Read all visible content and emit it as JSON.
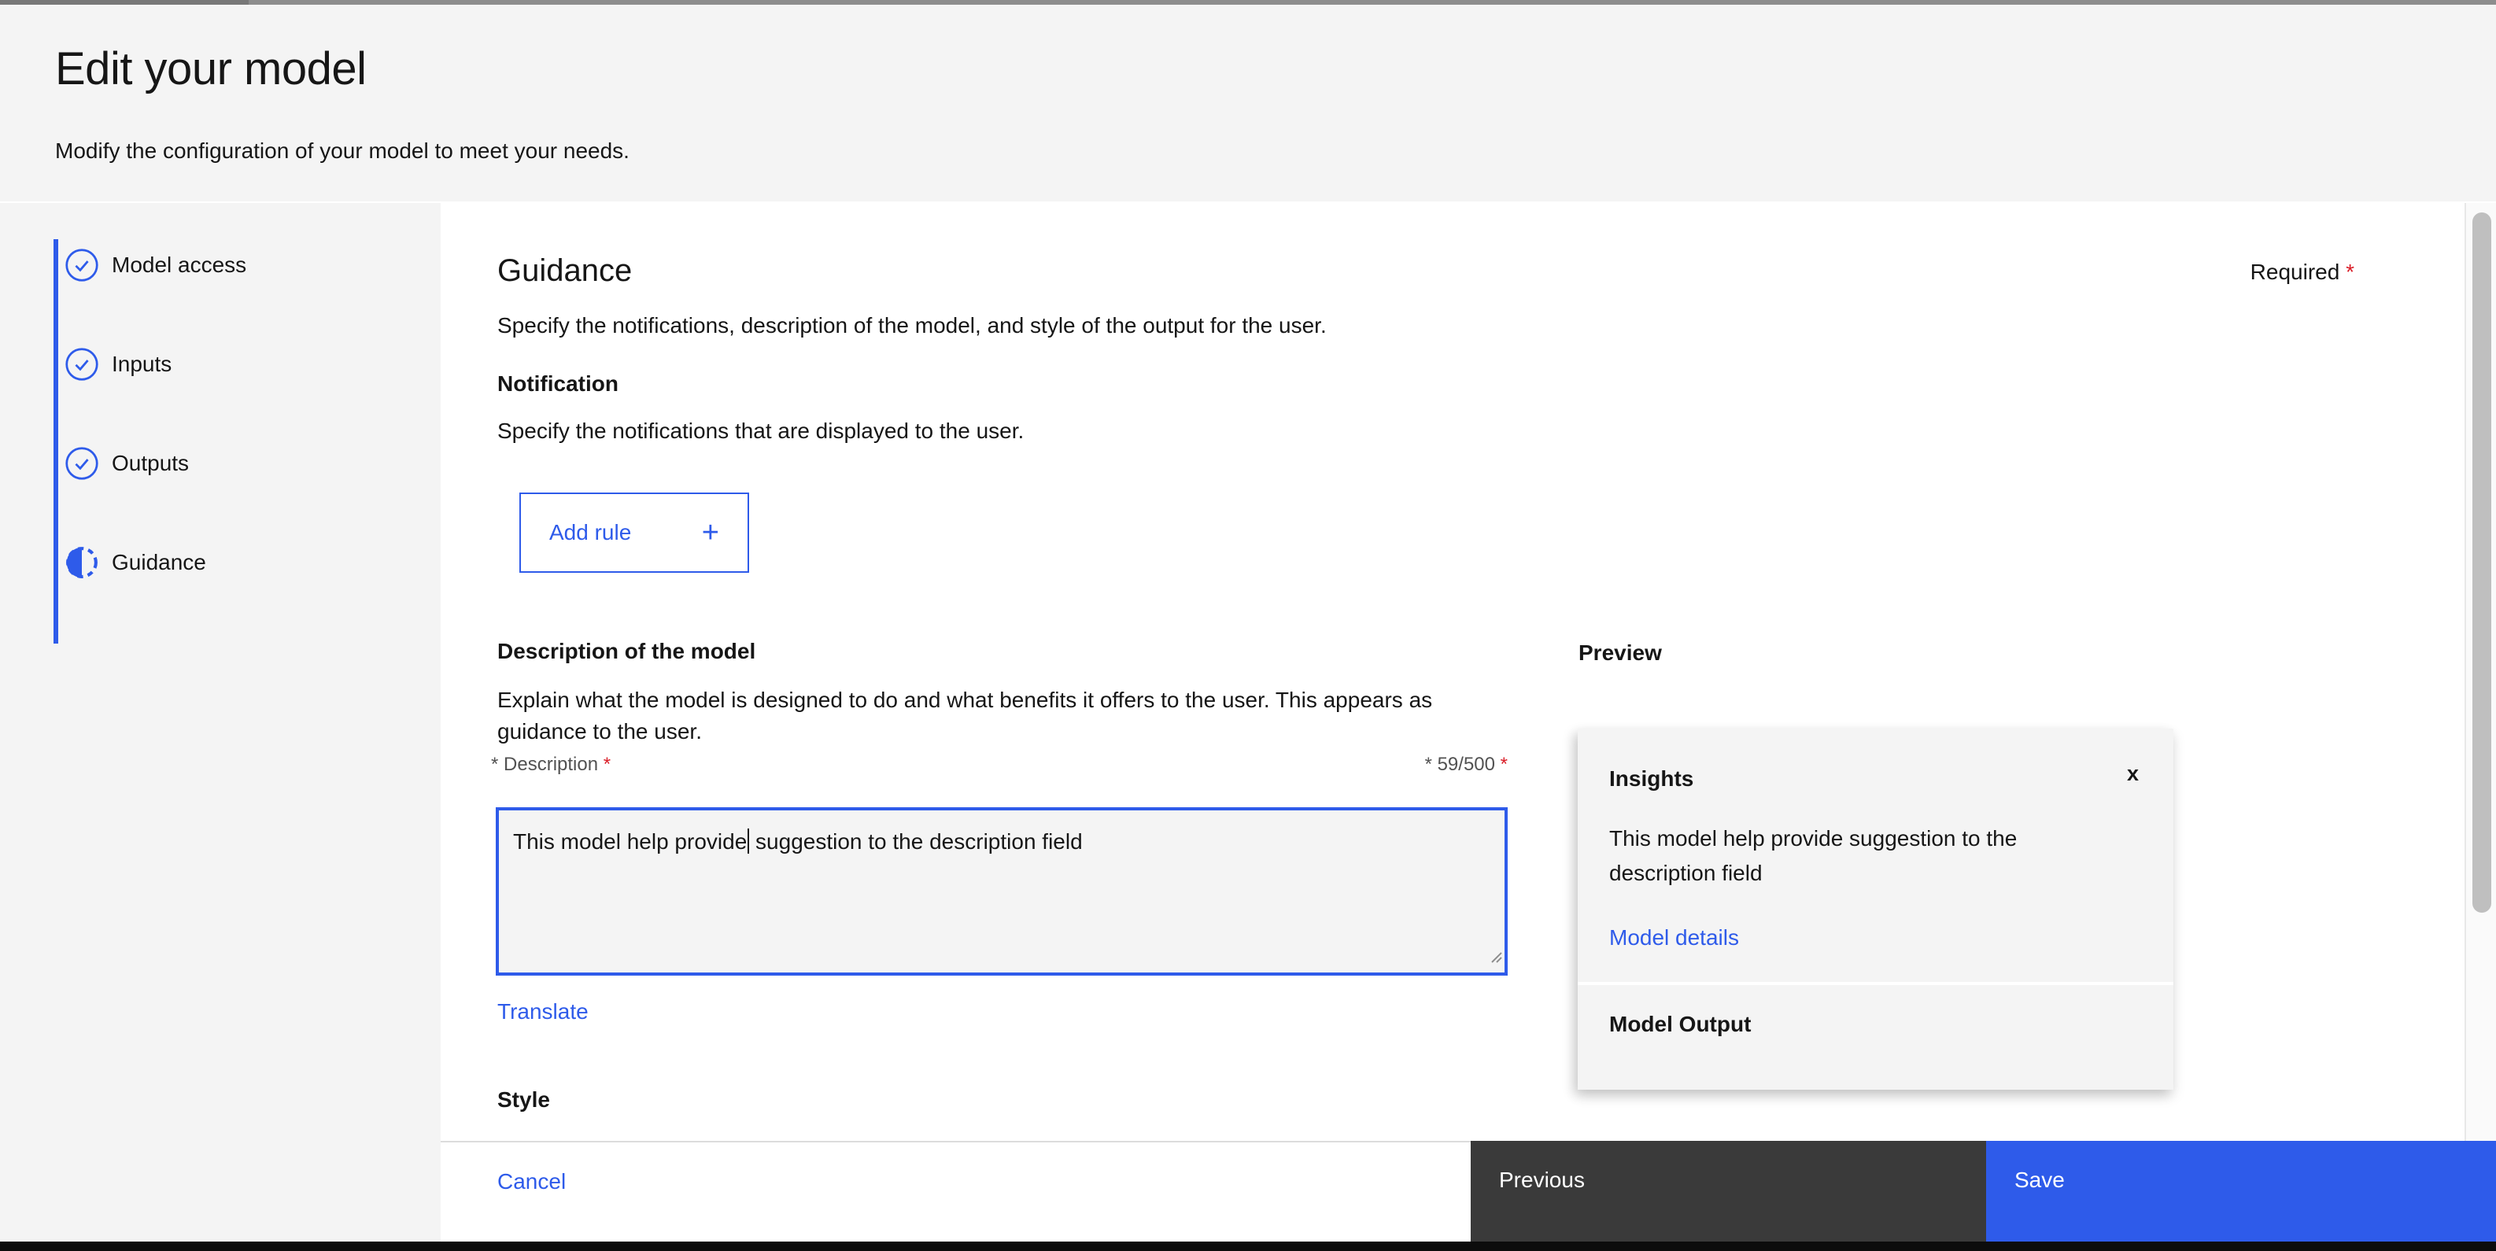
{
  "header": {
    "title": "Edit your model",
    "subtitle": "Modify the configuration of your model to meet your needs."
  },
  "steps": [
    {
      "label": "Model access",
      "state": "complete"
    },
    {
      "label": "Inputs",
      "state": "complete"
    },
    {
      "label": "Outputs",
      "state": "complete"
    },
    {
      "label": "Guidance",
      "state": "current"
    }
  ],
  "required_note": {
    "text": "Required",
    "asterisk": "*"
  },
  "guidance": {
    "heading": "Guidance",
    "description": "Specify the notifications, description of the model, and style of the output for the user."
  },
  "notification": {
    "title": "Notification",
    "description": "Specify the notifications that are displayed to the user.",
    "add_rule_label": "Add rule",
    "add_rule_plus": "+"
  },
  "description_section": {
    "title": "Description of the model",
    "description": "Explain what the model is designed to do and what benefits it offers to the user. This appears as guidance to the user.",
    "label_prefix_asterisk": "* ",
    "label": "Description",
    "label_required_asterisk": "*",
    "counter_prefix_asterisk": "* ",
    "counter": "59/500",
    "counter_required_asterisk": "*",
    "textarea_value_before_caret": "This model help provide",
    "textarea_value_after_caret": " suggestion to the description field",
    "translate_label": "Translate"
  },
  "style_section": {
    "title": "Style"
  },
  "preview": {
    "title": "Preview",
    "card": {
      "header": "Insights",
      "close_glyph": "x",
      "body": "This model help provide suggestion to the description field",
      "link": "Model details",
      "section_label": "Model Output"
    }
  },
  "footer": {
    "cancel_label": "Cancel",
    "previous_label": "Previous",
    "save_label": "Save"
  },
  "colors": {
    "accent": "#2e5bea",
    "danger": "#da1e28",
    "secondary_button": "#3a3a3a",
    "surface": "#f4f4f4"
  }
}
